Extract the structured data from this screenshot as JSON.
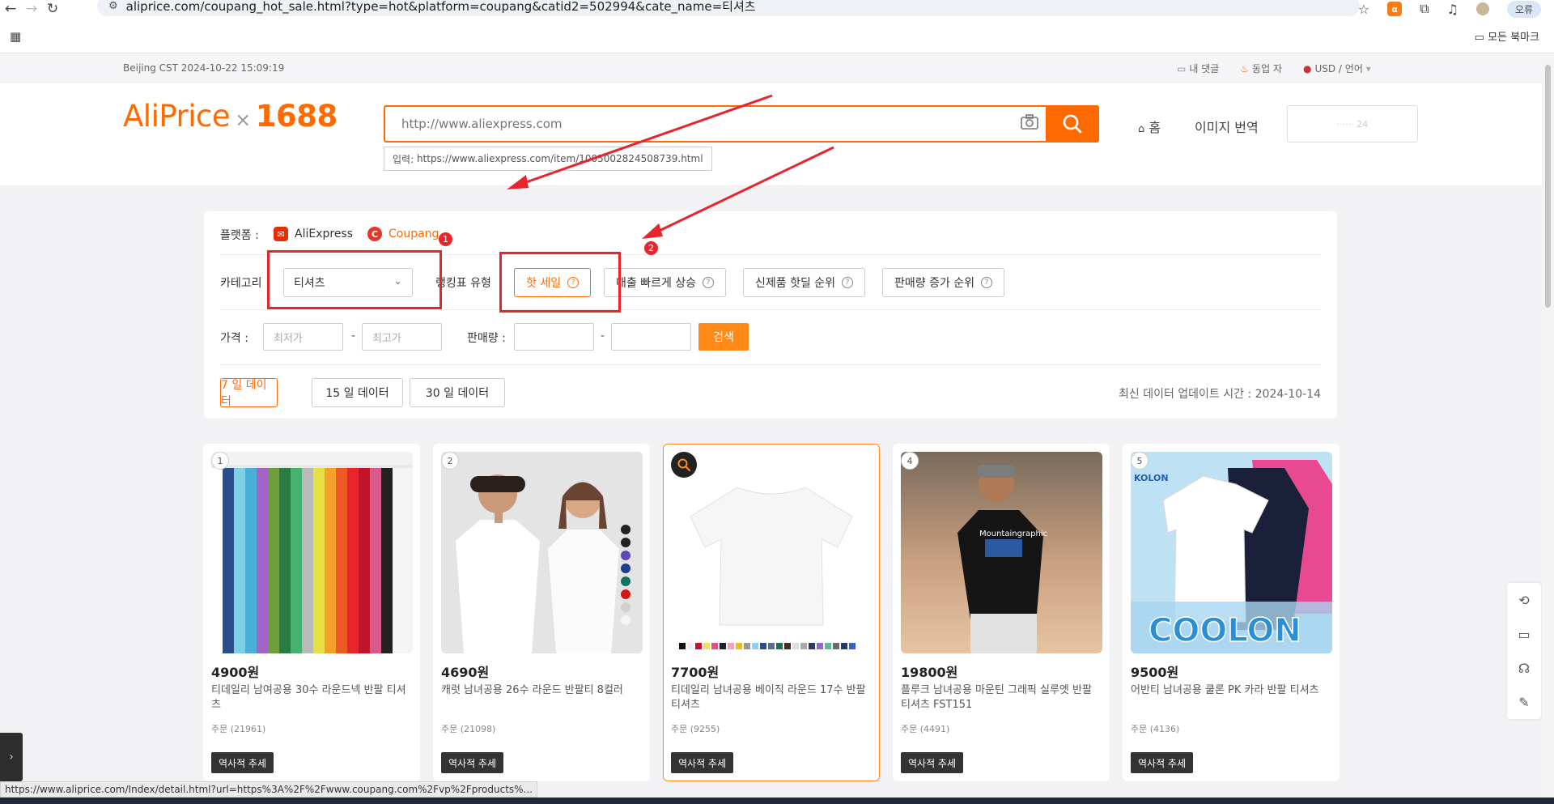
{
  "browser": {
    "url": "aliprice.com/coupang_hot_sale.html?type=hot&platform=coupang&catid2=502994&cate_name=티셔츠",
    "profile": "오류",
    "bookmarks_label": "모든 북마크",
    "status_url": "https://www.aliprice.com/Index/detail.html?url=https%3A%2F%2Fwww.coupang.com%2Fvp%2Fproducts%..."
  },
  "topbar": {
    "timezone": "Beijing CST  2024-10-22 15:09:19",
    "links": [
      "내 댓글",
      "동업 자",
      "USD / 언어"
    ]
  },
  "header": {
    "logo_main": "AliPrice",
    "logo_x": "×",
    "logo_partner": "1688",
    "search_placeholder": "http://www.aliexpress.com",
    "search_hint_label": "입력:",
    "search_hint_url": "https://www.aliexpress.com/item/1005002824508739.html",
    "nav_home": "홈",
    "nav_translate": "이미지 번역",
    "user": "······ 24"
  },
  "filters": {
    "platform_label": "플랫폼 :",
    "platforms": [
      "AliExpress",
      "Coupang"
    ],
    "active_platform": "Coupang",
    "category_label": "카테고리",
    "category_value": "티셔츠",
    "rank_type_label": "랭킹표 유형",
    "rank_types": [
      "핫 세일",
      "매출 빠르게 상승",
      "신제품 핫딜 순위",
      "판매량 증가 순위"
    ],
    "active_rank_type": "핫 세일",
    "price_label": "가격 :",
    "price_min_placeholder": "최저가",
    "price_max_placeholder": "최고가",
    "sales_label": "판매량 :",
    "range_sep": "-",
    "search_button": "검색",
    "day_options": [
      "7 일 데이터",
      "15 일 데이터",
      "30 일 데이터"
    ],
    "active_day": "7 일 데이터",
    "update_time": "최신 데이터 업데이트 시간 : 2024-10-14"
  },
  "annotations": {
    "badge_1": "1",
    "badge_2": "2",
    "color": "#e8242c"
  },
  "products": [
    {
      "rank": "1",
      "price": "4900원",
      "title": "티데일리 남여공용 30수 라운드넥 반팔 티셔츠",
      "orders": "주문 (21961)",
      "trend": "역사적 추세"
    },
    {
      "rank": "2",
      "price": "4690원",
      "title": "캐럿 남녀공용 26수 라운드 반팔티 8컬러",
      "orders": "주문 (21098)",
      "trend": "역사적 추세"
    },
    {
      "rank": "3",
      "price": "7700원",
      "title": "티데일리 남녀공용 베이직 라운드 17수 반팔 티셔츠",
      "orders": "주문 (9255)",
      "trend": "역사적 추세"
    },
    {
      "rank": "4",
      "price": "19800원",
      "title": "플루크 남녀공용 마운틴 그래픽 실루엣 반팔 티셔츠 FST151",
      "orders": "주문 (4491)",
      "trend": "역사적 추세"
    },
    {
      "rank": "5",
      "price": "9500원",
      "title": "어반티 남녀공용 쿨론 PK 카라 반팔 티셔츠",
      "orders": "주문 (4136)",
      "trend": "역사적 추세"
    }
  ],
  "image_text": {
    "brand_badge": "KOLON",
    "coolon": "COOLON",
    "tee_graphic": "Mountaingraphic"
  },
  "colors": {
    "accent": "#ff6a00",
    "search_button": "#ff8a18"
  }
}
